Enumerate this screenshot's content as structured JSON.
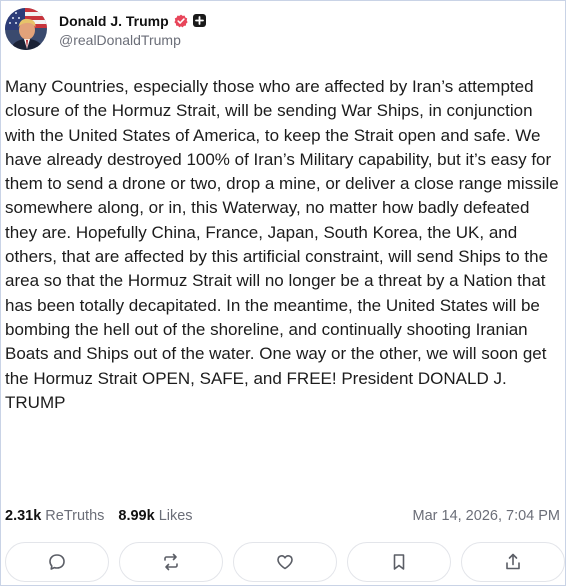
{
  "author": {
    "display_name": "Donald J. Trump",
    "handle": "@realDonaldTrump",
    "avatar_icon": "avatar-image",
    "verified_icon": "verified-badge-icon",
    "verified_color": "#e8455a",
    "plus_icon": "plus-badge-icon"
  },
  "post": {
    "text": "Many Countries, especially those who are affected by Iran’s attempted closure of the Hormuz Strait, will be sending War Ships, in conjunction with the United States of America, to keep the Strait open and safe. We have already destroyed 100% of Iran’s Military capability, but it’s easy for them to send a drone or two, drop a mine, or deliver a close range missile somewhere along, or in, this Waterway, no matter how badly defeated they are. Hopefully China, France, Japan, South Korea, the UK, and others, that are affected by this artificial constraint, will send Ships to the area so that the Hormuz Strait will no longer be a threat by a Nation that has been totally decapitated. In the meantime, the United States will be bombing the hell out of the shoreline, and continually shooting Iranian Boats and Ships out of the water. One way or the other, we will soon get the Hormuz Strait OPEN, SAFE, and FREE! President DONALD J. TRUMP"
  },
  "stats": {
    "retruths_count": "2.31k",
    "retruths_label": "ReTruths",
    "likes_count": "8.99k",
    "likes_label": "Likes",
    "timestamp": "Mar 14, 2026, 7:04 PM"
  },
  "actions": [
    {
      "name": "reply-button",
      "icon": "comment-icon"
    },
    {
      "name": "retruth-button",
      "icon": "repost-icon"
    },
    {
      "name": "like-button",
      "icon": "heart-icon"
    },
    {
      "name": "bookmark-button",
      "icon": "bookmark-icon"
    },
    {
      "name": "share-button",
      "icon": "share-icon"
    }
  ]
}
